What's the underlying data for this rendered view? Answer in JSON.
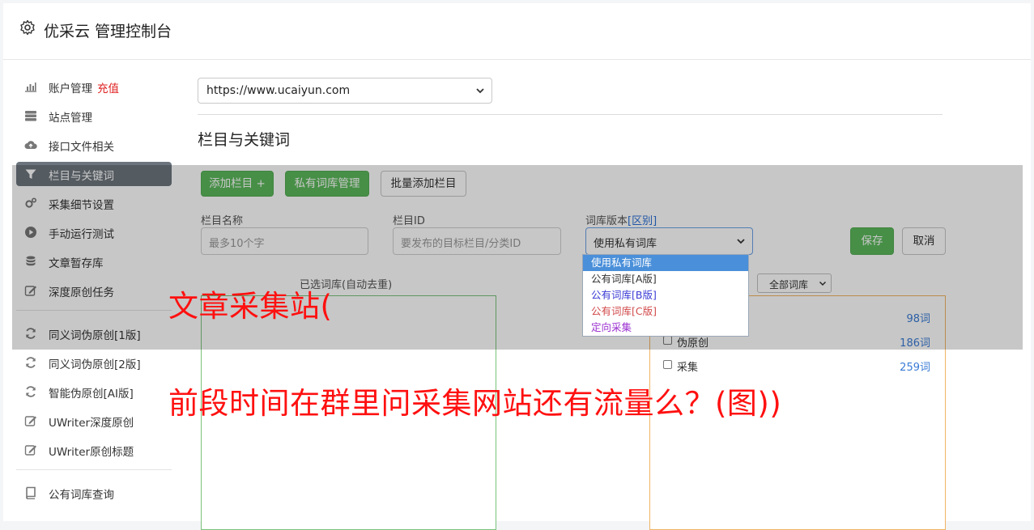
{
  "app": {
    "title": "优采云 管理控制台"
  },
  "sidebar": {
    "items": [
      {
        "label": "账户管理",
        "extra": "充值",
        "icon": "bar-chart-icon"
      },
      {
        "label": "站点管理",
        "icon": "server-icon"
      },
      {
        "label": "接口文件相关",
        "icon": "cloud-upload-icon"
      },
      {
        "label": "栏目与关键词",
        "icon": "filter-icon",
        "active": true
      },
      {
        "label": "采集细节设置",
        "icon": "gears-icon"
      },
      {
        "label": "手动运行测试",
        "icon": "play-circle-icon"
      },
      {
        "label": "文章暂存库",
        "icon": "database-icon"
      },
      {
        "label": "深度原创任务",
        "icon": "edit-icon"
      },
      {
        "label": "同义词伪原创[1版]",
        "icon": "refresh-icon"
      },
      {
        "label": "同义词伪原创[2版]",
        "icon": "refresh-icon"
      },
      {
        "label": "智能伪原创[AI版]",
        "icon": "refresh-icon"
      },
      {
        "label": "UWriter深度原创",
        "icon": "edit-icon"
      },
      {
        "label": "UWriter原创标题",
        "icon": "edit-icon"
      },
      {
        "label": "公有词库查询",
        "icon": "book-icon"
      }
    ]
  },
  "site_select": {
    "value": "https://www.ucaiyun.com"
  },
  "section": {
    "title": "栏目与关键词"
  },
  "toolbar": {
    "add_column": "添加栏目 +",
    "private_lib": "私有词库管理",
    "batch_add": "批量添加栏目"
  },
  "form": {
    "column_name_label": "栏目名称",
    "column_name_placeholder": "最多10个字",
    "column_id_label": "栏目ID",
    "column_id_placeholder": "要发布的目标栏目/分类ID",
    "lib_version_label": "词库版本",
    "lib_version_link": "[区别]",
    "lib_version_value": "使用私有词库",
    "save": "保存",
    "cancel": "取消"
  },
  "dropdown": {
    "options": [
      {
        "label": "使用私有词库",
        "color": "#ffffff",
        "selected": true
      },
      {
        "label": "公有词库[A版]",
        "color": "#333333"
      },
      {
        "label": "公有词库[B版]",
        "color": "#3b3bd6"
      },
      {
        "label": "公有词库[C版]",
        "color": "#d24a4a"
      },
      {
        "label": "定向采集",
        "color": "#9b30d0"
      }
    ]
  },
  "selected_lib": {
    "title": "已选词库(自动去重)"
  },
  "lib_filter": {
    "value": "全部词库"
  },
  "lib_list": [
    {
      "name": "",
      "count": "98词"
    },
    {
      "name": "伪原创",
      "count": "186词"
    },
    {
      "name": "采集",
      "count": "259词"
    }
  ],
  "overlay": {
    "line1": "文章采集站(",
    "line2": "前段时间在群里问采集网站还有流量么？(图))"
  },
  "colors": {
    "accent_green": "#5cb85c",
    "active_nav": "#6c757d",
    "overlay_text": "#ff1010",
    "link_blue": "#3a7bd5"
  }
}
